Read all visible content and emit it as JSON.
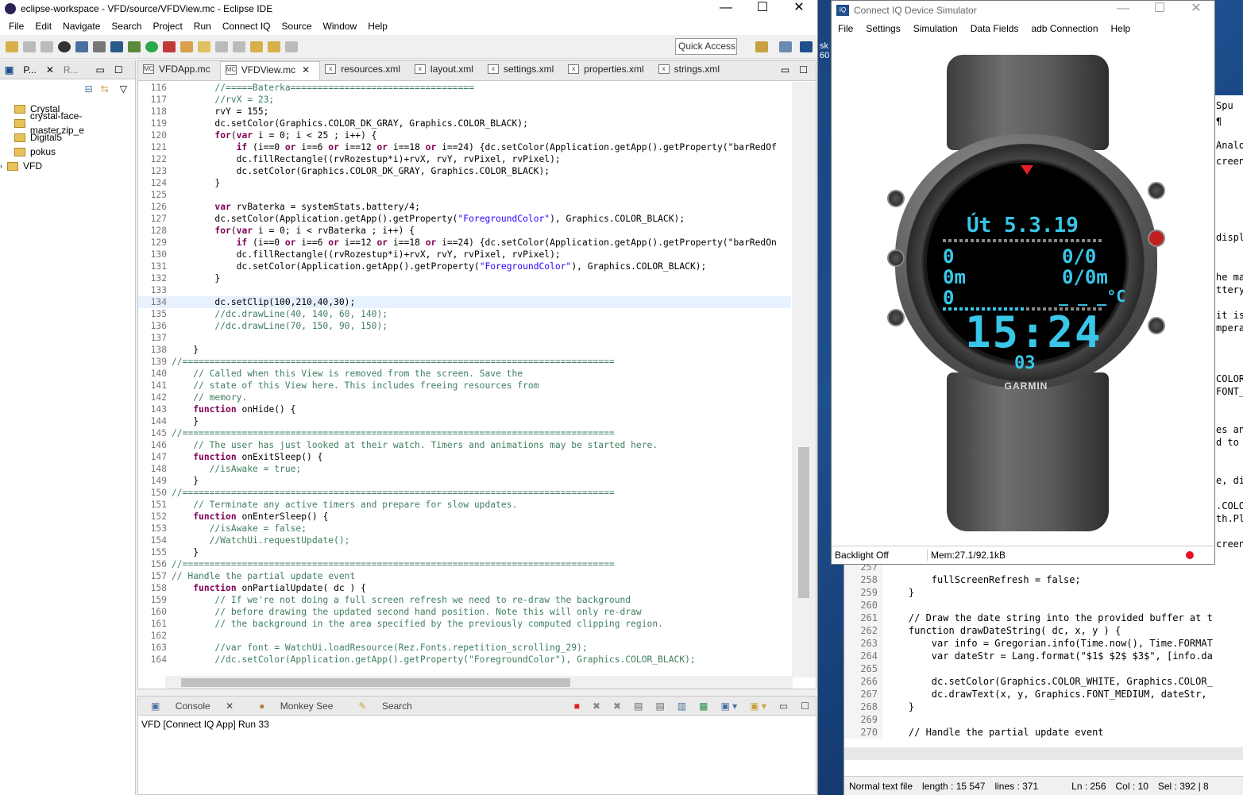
{
  "eclipse": {
    "title": "eclipse-workspace - VFD/source/VFDView.mc - Eclipse IDE",
    "menu": [
      "File",
      "Edit",
      "Navigate",
      "Search",
      "Project",
      "Run",
      "Connect IQ",
      "Source",
      "Window",
      "Help"
    ],
    "quick_access": "Quick Access",
    "left_tabs": [
      "P...",
      "R..."
    ],
    "tree": [
      "Crystal",
      "crystal-face-master.zip_e",
      "Digital5",
      "pokus",
      "VFD"
    ],
    "editor_tabs": [
      "VFDApp.mc",
      "VFDView.mc",
      "resources.xml",
      "layout.xml",
      "settings.xml",
      "properties.xml",
      "strings.xml"
    ],
    "console_tabs": [
      "Console",
      "Monkey See",
      "Search"
    ],
    "console_text": "VFD [Connect IQ App] Run 33"
  },
  "code_lines": [
    {
      "n": "116",
      "t": "        //=====Baterka=================================="
    },
    {
      "n": "117",
      "t": "        //rvX = 23;"
    },
    {
      "n": "118",
      "t": "        rvY = 155;"
    },
    {
      "n": "119",
      "t": "        dc.setColor(Graphics.COLOR_DK_GRAY, Graphics.COLOR_BLACK);"
    },
    {
      "n": "120",
      "t": "        for(var i = 0; i < 25 ; i++) {"
    },
    {
      "n": "121",
      "t": "            if (i==0 or i==6 or i==12 or i==18 or i==24) {dc.setColor(Application.getApp().getProperty(\"barRedOf"
    },
    {
      "n": "122",
      "t": "            dc.fillRectangle((rvRozestup*i)+rvX, rvY, rvPixel, rvPixel);"
    },
    {
      "n": "123",
      "t": "            dc.setColor(Graphics.COLOR_DK_GRAY, Graphics.COLOR_BLACK);"
    },
    {
      "n": "124",
      "t": "        }"
    },
    {
      "n": "125",
      "t": ""
    },
    {
      "n": "126",
      "t": "        var rvBaterka = systemStats.battery/4;"
    },
    {
      "n": "127",
      "t": "        dc.setColor(Application.getApp().getProperty(\"ForegroundColor\"), Graphics.COLOR_BLACK);"
    },
    {
      "n": "128",
      "t": "        for(var i = 0; i < rvBaterka ; i++) {"
    },
    {
      "n": "129",
      "t": "            if (i==0 or i==6 or i==12 or i==18 or i==24) {dc.setColor(Application.getApp().getProperty(\"barRedOn"
    },
    {
      "n": "130",
      "t": "            dc.fillRectangle((rvRozestup*i)+rvX, rvY, rvPixel, rvPixel);"
    },
    {
      "n": "131",
      "t": "            dc.setColor(Application.getApp().getProperty(\"ForegroundColor\"), Graphics.COLOR_BLACK);"
    },
    {
      "n": "132",
      "t": "        }"
    },
    {
      "n": "133",
      "t": ""
    },
    {
      "n": "134",
      "t": "        dc.setClip(100,210,40,30);"
    },
    {
      "n": "135",
      "t": "        //dc.drawLine(40, 140, 60, 140);"
    },
    {
      "n": "136",
      "t": "        //dc.drawLine(70, 150, 90, 150);"
    },
    {
      "n": "137",
      "t": ""
    },
    {
      "n": "138",
      "t": "    }"
    },
    {
      "n": "139",
      "t": "//================================================================================"
    },
    {
      "n": "140",
      "t": "    // Called when this View is removed from the screen. Save the"
    },
    {
      "n": "141",
      "t": "    // state of this View here. This includes freeing resources from"
    },
    {
      "n": "142",
      "t": "    // memory."
    },
    {
      "n": "143",
      "t": "    function onHide() {"
    },
    {
      "n": "144",
      "t": "    }"
    },
    {
      "n": "145",
      "t": "//================================================================================"
    },
    {
      "n": "146",
      "t": "    // The user has just looked at their watch. Timers and animations may be started here."
    },
    {
      "n": "147",
      "t": "    function onExitSleep() {"
    },
    {
      "n": "148",
      "t": "       //isAwake = true;"
    },
    {
      "n": "149",
      "t": "    }"
    },
    {
      "n": "150",
      "t": "//================================================================================"
    },
    {
      "n": "151",
      "t": "    // Terminate any active timers and prepare for slow updates."
    },
    {
      "n": "152",
      "t": "    function onEnterSleep() {"
    },
    {
      "n": "153",
      "t": "       //isAwake = false;"
    },
    {
      "n": "154",
      "t": "       //WatchUi.requestUpdate();"
    },
    {
      "n": "155",
      "t": "    }"
    },
    {
      "n": "156",
      "t": "//================================================================================"
    },
    {
      "n": "157",
      "t": "// Handle the partial update event"
    },
    {
      "n": "158",
      "t": "    function onPartialUpdate( dc ) {"
    },
    {
      "n": "159",
      "t": "        // If we're not doing a full screen refresh we need to re-draw the background"
    },
    {
      "n": "160",
      "t": "        // before drawing the updated second hand position. Note this will only re-draw"
    },
    {
      "n": "161",
      "t": "        // the background in the area specified by the previously computed clipping region."
    },
    {
      "n": "162",
      "t": ""
    },
    {
      "n": "163",
      "t": "        //var font = WatchUi.loadResource(Rez.Fonts.repetition_scrolling_29);"
    },
    {
      "n": "164",
      "t": "        //dc.setColor(Application.getApp().getProperty(\"ForegroundColor\"), Graphics.COLOR_BLACK);"
    }
  ],
  "right_code": [
    {
      "n": "257",
      "t": ""
    },
    {
      "n": "258",
      "t": "        fullScreenRefresh = false;"
    },
    {
      "n": "259",
      "t": "    }"
    },
    {
      "n": "260",
      "t": ""
    },
    {
      "n": "261",
      "t": "    // Draw the date string into the provided buffer at t"
    },
    {
      "n": "262",
      "t": "    function drawDateString( dc, x, y ) {"
    },
    {
      "n": "263",
      "t": "        var info = Gregorian.info(Time.now(), Time.FORMAT"
    },
    {
      "n": "264",
      "t": "        var dateStr = Lang.format(\"$1$ $2$ $3$\", [info.da"
    },
    {
      "n": "265",
      "t": ""
    },
    {
      "n": "266",
      "t": "        dc.setColor(Graphics.COLOR_WHITE, Graphics.COLOR_"
    },
    {
      "n": "267",
      "t": "        dc.drawText(x, y, Graphics.FONT_MEDIUM, dateStr,"
    },
    {
      "n": "268",
      "t": "    }"
    },
    {
      "n": "269",
      "t": ""
    },
    {
      "n": "270",
      "t": "    // Handle the partial update event"
    }
  ],
  "right_status": [
    "Normal text file",
    "length : 15 547",
    "lines : 371",
    "Ln : 256",
    "Col : 10",
    "Sel : 392 | 8"
  ],
  "far_right": [
    {
      "t": "Spu"
    },
    {
      "t": "¶"
    },
    {
      "t": "Analog"
    },
    {
      "t": "creen"
    },
    {
      "t": "displ"
    },
    {
      "t": "he ma"
    },
    {
      "t": "ttery"
    },
    {
      "t": "it is"
    },
    {
      "t": "mpera"
    },
    {
      "t": "COLOR_"
    },
    {
      "t": "FONT_"
    },
    {
      "t": "es an"
    },
    {
      "t": "d to"
    },
    {
      "t": "e, di"
    },
    {
      "t": ".COLO"
    },
    {
      "t": "th.Pl"
    },
    {
      "t": "creen"
    }
  ],
  "desktop_edge": [
    "sk",
    "60"
  ],
  "simulator": {
    "title": "Connect IQ Device Simulator",
    "menu": [
      "File",
      "Settings",
      "Simulation",
      "Data Fields",
      "adb Connection",
      "Help"
    ],
    "status_left": "Backlight Off",
    "status_mem": "Mem:27.1/92.1kB",
    "watch": {
      "date": "Út 5.3.19",
      "left1": "0",
      "left2": "0m",
      "left3": "0",
      "right1": "0/0",
      "right2": "0/0m",
      "right3": "_ _ _°C",
      "time": "15:24",
      "seconds": "03",
      "brand": "GARMIN",
      "battery_level": 0.52
    }
  }
}
